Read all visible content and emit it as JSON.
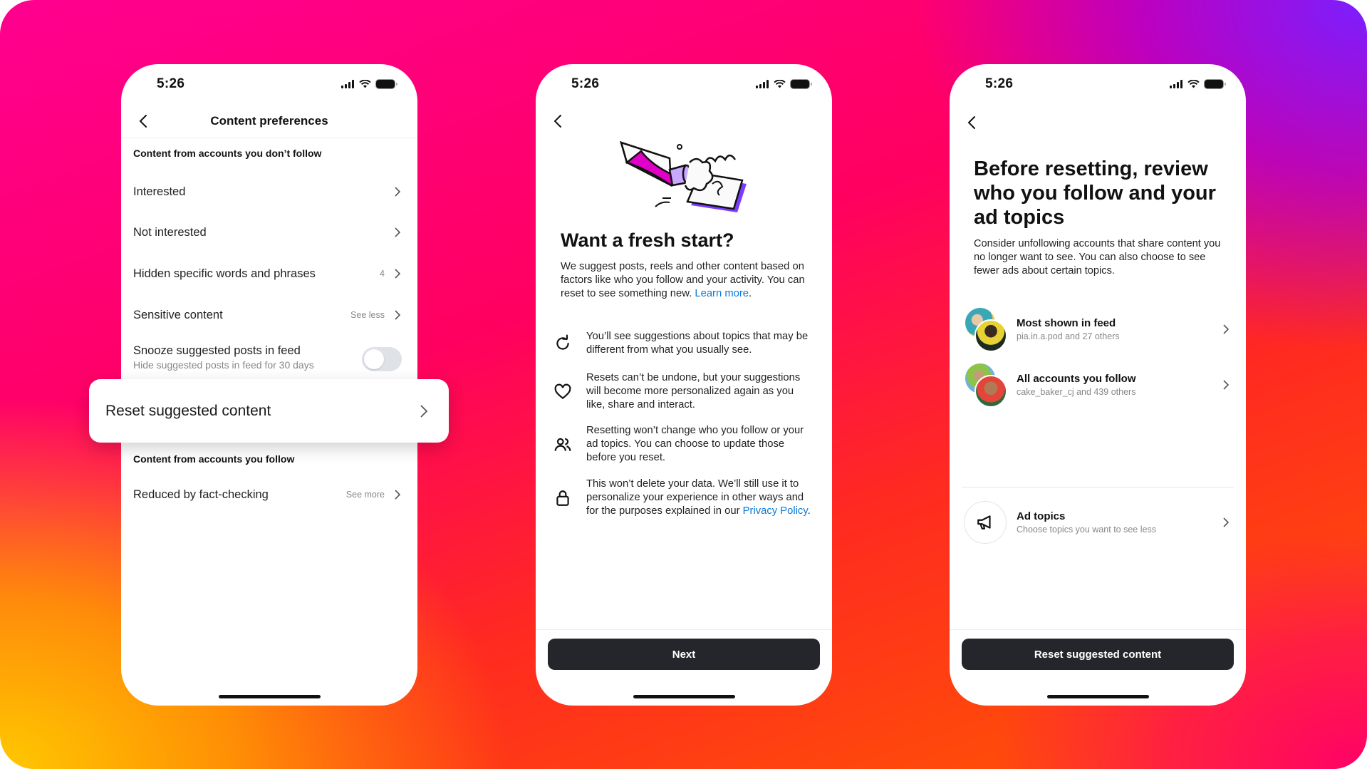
{
  "colors": {
    "link": "#0a78d6",
    "button_bg": "#25262b",
    "toggle_off": "#dfe2e7",
    "pencil_magenta": "#e000c8",
    "eraser_lavender": "#c9a8ff",
    "notebook_purple": "#7b3cff"
  },
  "status_bar": {
    "time": "5:26",
    "icons": [
      "signal-icon",
      "wifi-icon",
      "battery-icon"
    ]
  },
  "screen1": {
    "title": "Content preferences",
    "back_icon": "chevron-left-icon",
    "section1_header": "Content from accounts you don’t follow",
    "items": [
      {
        "label": "Interested",
        "meta": ""
      },
      {
        "label": "Not interested",
        "meta": ""
      },
      {
        "label": "Hidden specific words and phrases",
        "meta": "4"
      },
      {
        "label": "Sensitive content",
        "meta": "See less"
      }
    ],
    "snooze": {
      "label": "Snooze suggested posts in feed",
      "sublabel": "Hide suggested posts in feed for 30 days",
      "enabled": false
    },
    "highlight_item": "Reset suggested content",
    "section2_header": "Content from accounts you follow",
    "items2": [
      {
        "label": "Reduced by fact-checking",
        "meta": "See more"
      }
    ]
  },
  "screen2": {
    "title": "Want a fresh start?",
    "description": "We suggest posts, reels and other content based on factors like who you follow and your activity. You can reset to see something new. ",
    "learn_more": "Learn more",
    "period": ".",
    "info": [
      {
        "icon": "refresh-icon",
        "text": "You’ll see suggestions about topics that may be different from what you usually see."
      },
      {
        "icon": "heart-icon",
        "text": "Resets can’t be undone, but your suggestions will become more personalized again as you like, share and interact."
      },
      {
        "icon": "people-icon",
        "text": "Resetting won’t change who you follow or your ad topics. You can choose to update those before you reset."
      },
      {
        "icon": "lock-icon",
        "text": "This won’t delete your data. We’ll still use it to personalize your experience in other ways and for the purposes explained in our ",
        "link": "Privacy Policy",
        "suffix": "."
      }
    ],
    "button": "Next"
  },
  "screen3": {
    "title": "Before resetting, review who you follow and your ad topics",
    "description": "Consider unfollowing accounts that share content you no longer want to see. You can also choose to see fewer ads about certain topics.",
    "rows": [
      {
        "title": "Most shown in feed",
        "subtitle": "pia.in.a.pod and 27 others"
      },
      {
        "title": "All accounts you follow",
        "subtitle": "cake_baker_cj and 439 others"
      },
      {
        "title": "Ad topics",
        "subtitle": "Choose topics you want to see less",
        "icon": "megaphone-icon"
      }
    ],
    "button": "Reset suggested content"
  }
}
